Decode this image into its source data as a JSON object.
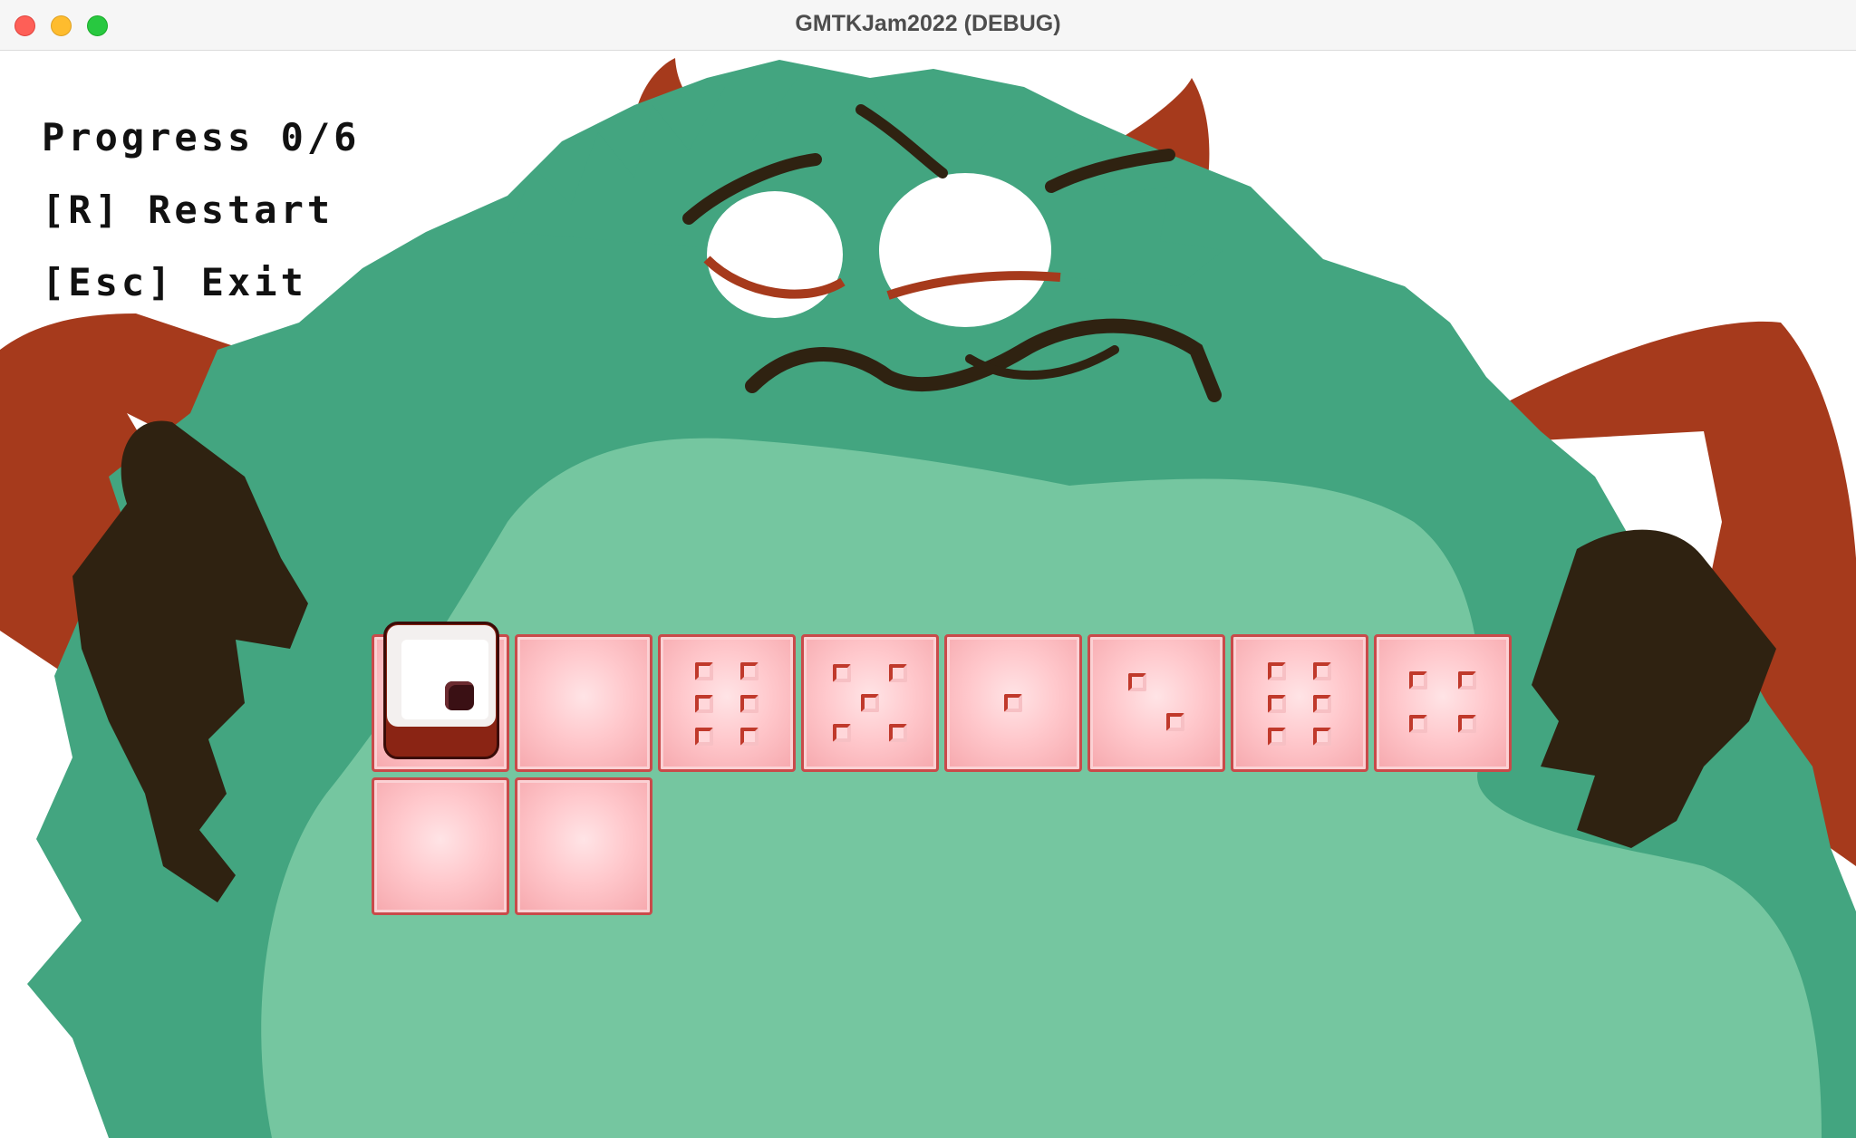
{
  "window": {
    "title": "GMTKJam2022 (DEBUG)",
    "controls": [
      "close",
      "minimize",
      "maximize"
    ]
  },
  "hud": {
    "progress": "Progress 0/6",
    "restart": "[R] Restart",
    "exit": "[Esc] Exit"
  },
  "game": {
    "progress_completed": 0,
    "progress_total": 6,
    "player_die_top_face": 1,
    "colors": {
      "monster_fur": "#43a580",
      "monster_belly": "#75c6a0",
      "monster_horns": "#a63a1c",
      "monster_hands": "#2f2211",
      "tile": "#ffc4c8",
      "tile_border": "#c94a4a",
      "die_body": "#8a2414"
    },
    "board": {
      "row1": [
        {
          "tile": "start",
          "face": 0,
          "occupied_by": "player-die"
        },
        {
          "tile": "blank",
          "face": 0
        },
        {
          "tile": "target",
          "face": 6
        },
        {
          "tile": "target",
          "face": 5
        },
        {
          "tile": "target",
          "face": 1
        },
        {
          "tile": "target",
          "face": 2
        },
        {
          "tile": "target",
          "face": 6
        },
        {
          "tile": "target",
          "face": 4
        }
      ],
      "row2": [
        {
          "tile": "blank",
          "face": 0
        },
        {
          "tile": "blank",
          "face": 0
        }
      ]
    }
  }
}
